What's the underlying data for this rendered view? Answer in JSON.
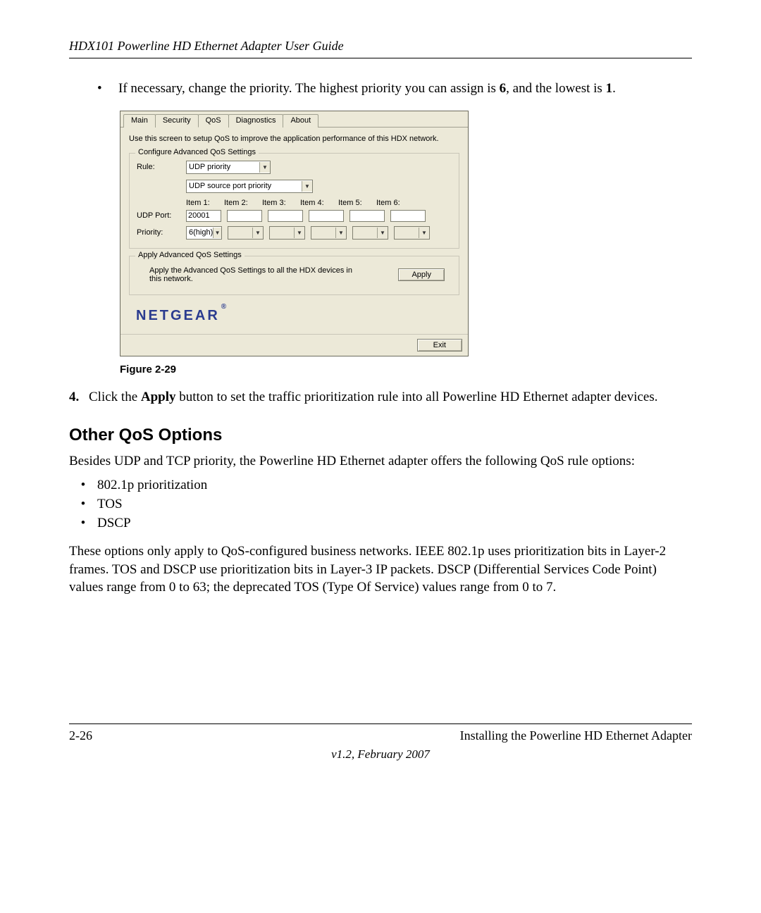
{
  "header": {
    "title": "HDX101 Powerline HD Ethernet Adapter User Guide"
  },
  "step_bullet": {
    "prefix": "If necessary, change the priority. The highest priority you can assign is ",
    "high": "6",
    "mid": ", and the lowest is ",
    "low": "1",
    "suffix": "."
  },
  "shot": {
    "tabs": [
      "Main",
      "Security",
      "QoS",
      "Diagnostics",
      "About"
    ],
    "active_tab_index": 2,
    "intro": "Use this screen to setup QoS to improve the application performance of this HDX network.",
    "fs1_legend": "Configure Advanced QoS Settings",
    "rule_label": "Rule:",
    "rule_value": "UDP priority",
    "rule2_value": "UDP source port priority",
    "item_headers": [
      "Item 1:",
      "Item 2:",
      "Item 3:",
      "Item 4:",
      "Item 5:",
      "Item 6:"
    ],
    "udp_port_label": "UDP Port:",
    "udp_port_value": "20001",
    "priority_label": "Priority:",
    "priority_value": "6(high)",
    "fs2_legend": "Apply Advanced QoS Settings",
    "apply_desc": "Apply the Advanced QoS Settings to all the HDX devices in this network.",
    "apply_btn": "Apply",
    "brand": "NETGEAR",
    "exit_btn": "Exit"
  },
  "fig_caption": "Figure 2-29",
  "step4": {
    "num": "4.",
    "p1": "Click the ",
    "b1": "Apply",
    "p2": " button to set the traffic prioritization rule into all Powerline HD Ethernet adapter devices."
  },
  "section_title": "Other QoS Options",
  "para1": "Besides UDP and TCP priority, the Powerline HD Ethernet adapter offers the following QoS rule options:",
  "list": [
    "802.1p prioritization",
    "TOS",
    "DSCP"
  ],
  "para2": "These options only apply to QoS-configured business networks. IEEE 802.1p uses prioritization bits in Layer-2 frames. TOS and DSCP use prioritization bits in Layer-3 IP packets. DSCP (Differential Services Code Point) values range from 0 to 63; the deprecated TOS (Type Of Service) values range from 0 to 7.",
  "footer": {
    "page": "2-26",
    "chapter": "Installing the Powerline HD Ethernet Adapter",
    "version": "v1.2, February 2007"
  }
}
